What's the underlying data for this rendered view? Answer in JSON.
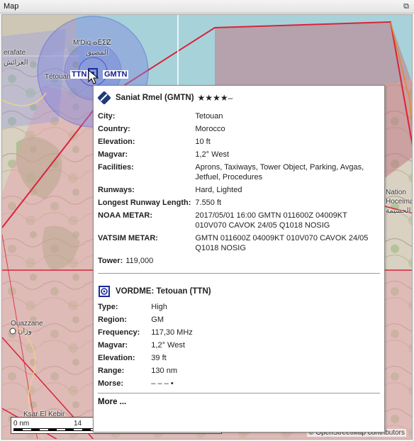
{
  "window": {
    "title": "Map",
    "float_button": "⧉"
  },
  "map": {
    "labels": {
      "town_top_left": "erafate",
      "arabic_top_left": "العرائش",
      "mdiq": "M'Diq ⴰⴹⵉⵇ",
      "mdiq_arabic": "المضيق",
      "tetouan": "Tétouan",
      "ouazzane": "Ouazzane",
      "ouazzane_arabic": "وزان",
      "ksar": "Ksar El Kebir",
      "right_nation": "Nation",
      "right_hoceima": "Hoceima",
      "right_arabic": "الحسيمة"
    },
    "vor_label": "TTN",
    "airport_label": "GMTN",
    "scale": {
      "zero": "0 nm",
      "max": "14"
    },
    "attribution": "© OpenStreetMap contributors",
    "colors": {
      "airspace_red": "#d8243c",
      "airspace_blue": "#4a55d8",
      "vor_blue": "#1a2a9a"
    }
  },
  "tooltip": {
    "airport": {
      "icon": "airport-runway-icon",
      "name": "Saniat Rmel (GMTN)",
      "rating": "★★★★–",
      "fields": [
        {
          "key": "City:",
          "value": "Tetouan"
        },
        {
          "key": "Country:",
          "value": "Morocco"
        },
        {
          "key": "Elevation:",
          "value": "10 ft"
        },
        {
          "key": "Magvar:",
          "value": "1,2° West"
        },
        {
          "key": "Facilities:",
          "value": "Aprons, Taxiways, Tower Object, Parking, Avgas, Jetfuel, Procedures"
        },
        {
          "key": "Runways:",
          "value": "Hard, Lighted"
        },
        {
          "key": "Longest Runway Length:",
          "value": "7.550 ft"
        },
        {
          "key": "NOAA METAR:",
          "value": "2017/05/01 16:00 GMTN 011600Z 04009KT 010V070 CAVOK 24/05 Q1018 NOSIG"
        },
        {
          "key": "VATSIM METAR:",
          "value": "GMTN 011600Z 04009KT 010V070 CAVOK 24/05 Q1018 NOSIG"
        }
      ],
      "tower_key": "Tower:",
      "tower_value": "119,000"
    },
    "navaid": {
      "icon": "vordme-icon",
      "name": "VORDME: Tetouan (TTN)",
      "fields": [
        {
          "key": "Type:",
          "value": "High"
        },
        {
          "key": "Region:",
          "value": "GM"
        },
        {
          "key": "Frequency:",
          "value": "117,30 MHz"
        },
        {
          "key": "Magvar:",
          "value": "1,2° West"
        },
        {
          "key": "Elevation:",
          "value": "39 ft"
        },
        {
          "key": "Range:",
          "value": "130 nm"
        },
        {
          "key": "Morse:",
          "value": "– – – •"
        }
      ]
    },
    "more": "More ..."
  }
}
